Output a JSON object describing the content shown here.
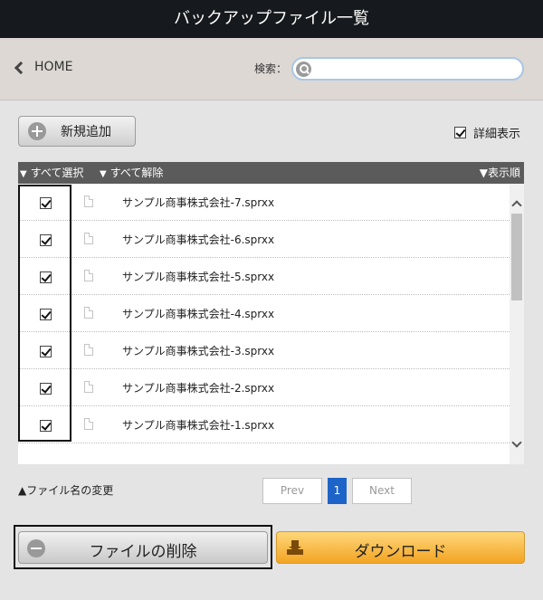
{
  "window": {
    "title": "バックアップファイル一覧"
  },
  "nav": {
    "home_label": "HOME",
    "search_label": "検索：",
    "search_value": "",
    "search_placeholder": ""
  },
  "toolbar": {
    "add_label": "新規追加",
    "detail_label": "詳細表示",
    "detail_checked": true
  },
  "list_header": {
    "select_all": "すべて選択",
    "deselect_all": "すべて解除",
    "sort_order": "▼表示順"
  },
  "files": [
    {
      "name": "サンプル商事株式会社-7.sprxx",
      "checked": true
    },
    {
      "name": "サンプル商事株式会社-6.sprxx",
      "checked": true
    },
    {
      "name": "サンプル商事株式会社-5.sprxx",
      "checked": true
    },
    {
      "name": "サンプル商事株式会社-4.sprxx",
      "checked": true
    },
    {
      "name": "サンプル商事株式会社-3.sprxx",
      "checked": true
    },
    {
      "name": "サンプル商事株式会社-2.sprxx",
      "checked": true
    },
    {
      "name": "サンプル商事株式会社-1.sprxx",
      "checked": true
    }
  ],
  "footer": {
    "rename_label": "▲ファイル名の変更"
  },
  "pager": {
    "prev": "Prev",
    "current": "1",
    "next": "Next"
  },
  "actions": {
    "delete_label": "ファイルの削除",
    "download_label": "ダウンロード"
  },
  "colors": {
    "title_bg": "#16191d",
    "accent_blue": "#1e64c8",
    "download_orange": "#f3a422"
  }
}
